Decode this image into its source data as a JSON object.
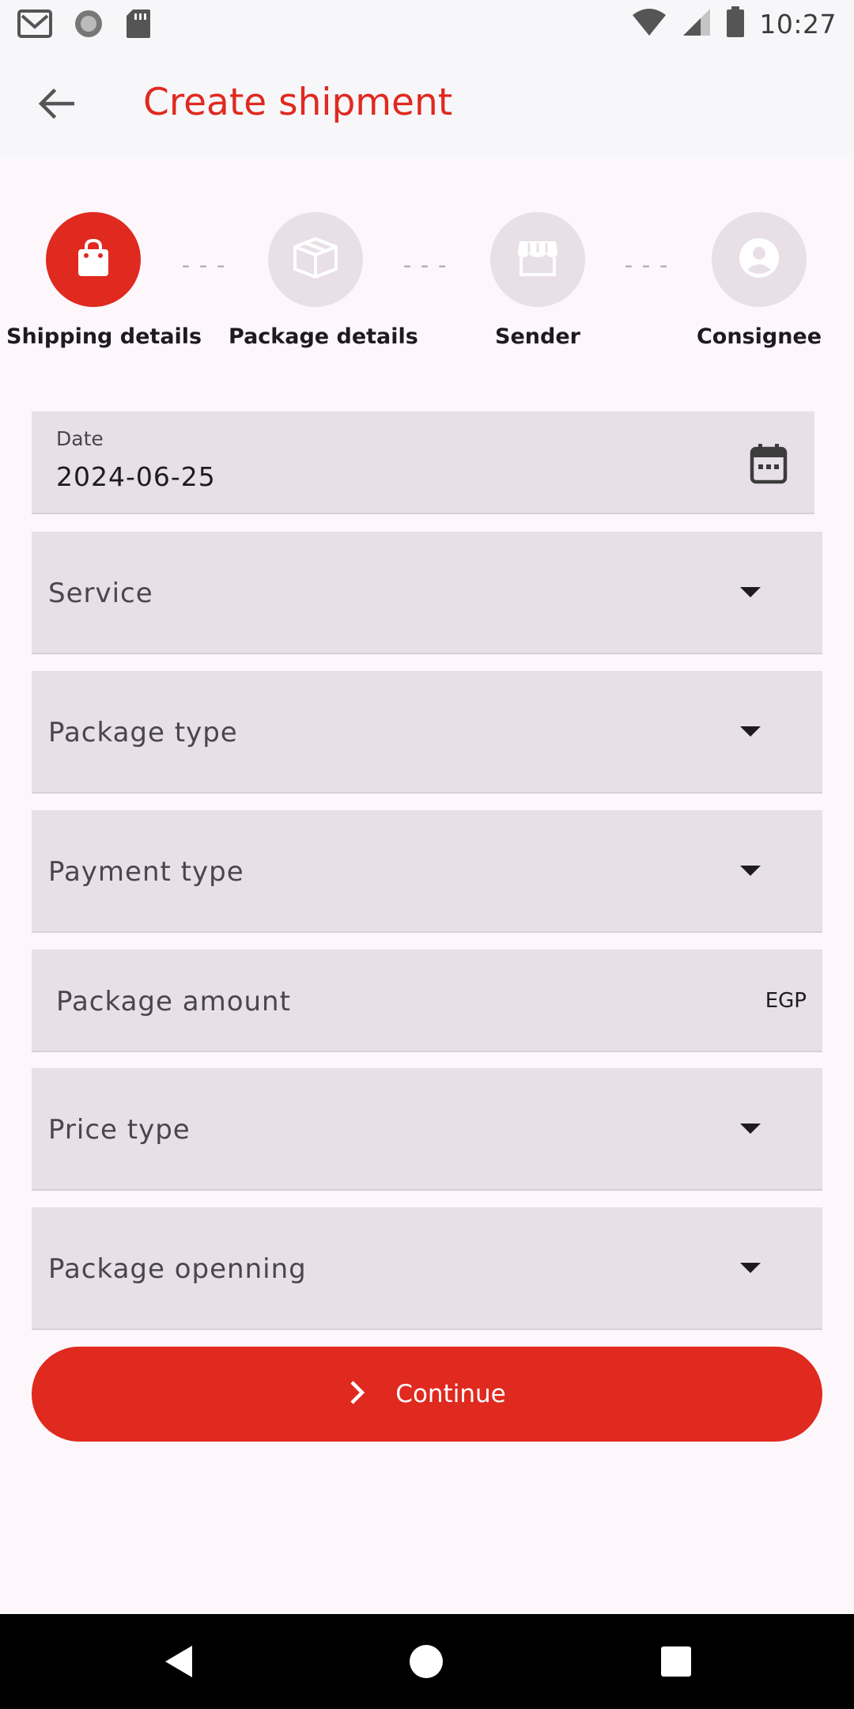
{
  "status_bar": {
    "time": "10:27",
    "left_icons": [
      "gmail-icon",
      "circle-app-icon",
      "sd-card-icon"
    ],
    "right_icons": [
      "wifi-icon",
      "signal-icon",
      "battery-icon"
    ]
  },
  "toolbar": {
    "title": "Create shipment",
    "back_icon": "arrow-back-icon"
  },
  "stepper": {
    "steps": [
      {
        "label": "Shipping details",
        "icon": "shopping-bag-icon",
        "active": true
      },
      {
        "label": "Package details",
        "icon": "package-box-icon",
        "active": false
      },
      {
        "label": "Sender",
        "icon": "storefront-icon",
        "active": false
      },
      {
        "label": "Consignee",
        "icon": "account-circle-icon",
        "active": false
      }
    ],
    "separator": "---"
  },
  "form": {
    "date": {
      "label": "Date",
      "value": "2024-06-25",
      "icon": "calendar-icon"
    },
    "service": {
      "label": "Service"
    },
    "package_type": {
      "label": "Package type"
    },
    "payment_type": {
      "label": "Payment type"
    },
    "package_amount": {
      "label": "Package amount",
      "suffix": "EGP"
    },
    "price_type": {
      "label": "Price type"
    },
    "package_opening": {
      "label": "Package openning"
    }
  },
  "continue_button": {
    "label": "Continue",
    "icon": "chevron-right-icon"
  },
  "colors": {
    "accent": "#e0291f",
    "field_bg": "#e7e0e7",
    "inactive_step": "#e8e0e6",
    "background": "#fdf7fb"
  },
  "nav_bar": {
    "icons": [
      "back-triangle-icon",
      "home-circle-icon",
      "recents-square-icon"
    ]
  }
}
